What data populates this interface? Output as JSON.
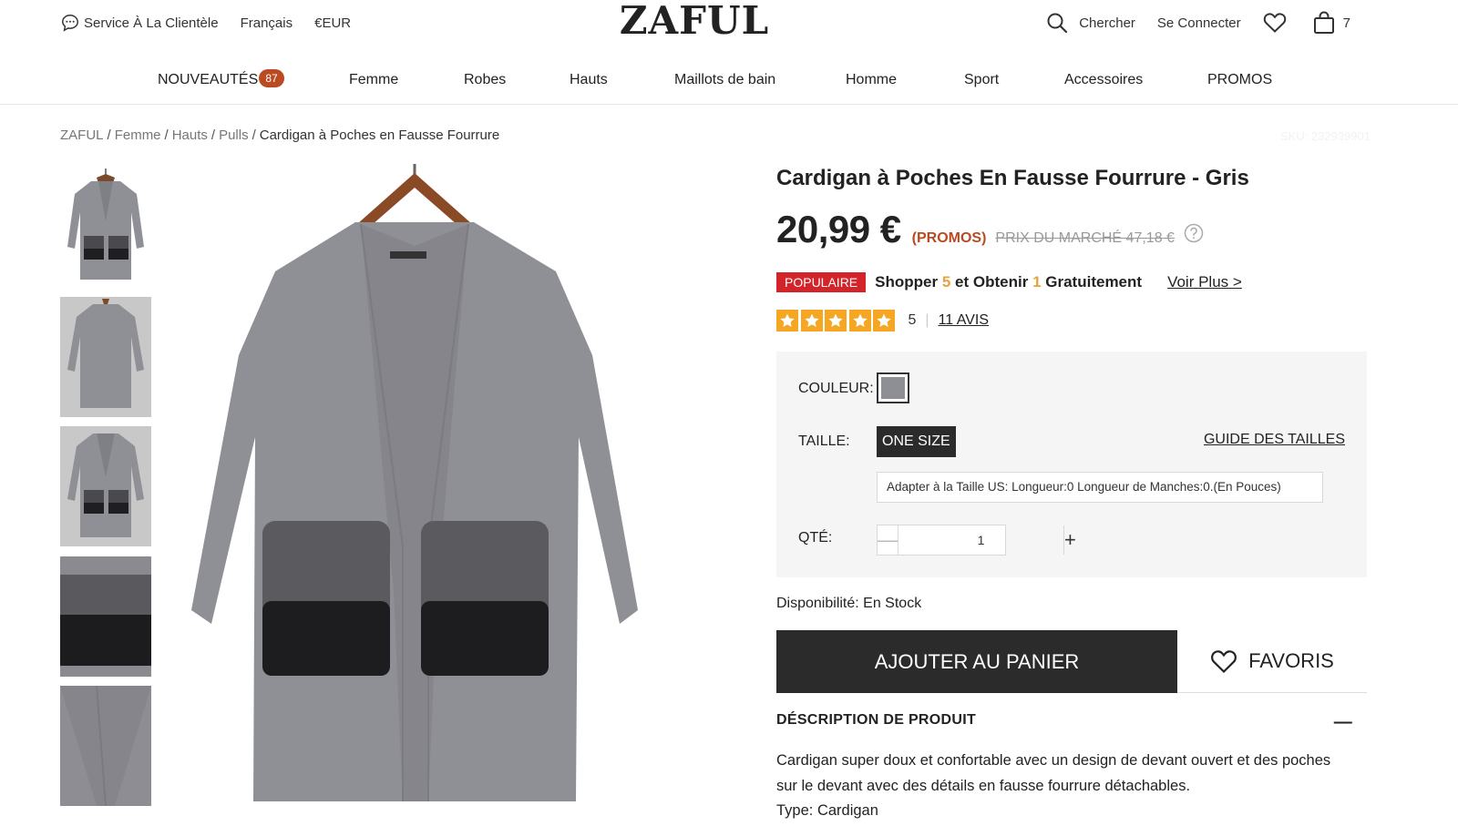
{
  "topbar": {
    "service": "Service À La Clientèle",
    "language": "Français",
    "currency": "€EUR",
    "logo": "ZAFUL",
    "search": "Chercher",
    "login": "Se Connecter",
    "cart_count": "7"
  },
  "nav": {
    "items": [
      {
        "label": "NOUVEAUTÉS",
        "badge": "87"
      },
      {
        "label": "Femme"
      },
      {
        "label": "Robes"
      },
      {
        "label": "Hauts"
      },
      {
        "label": "Maillots de bain"
      },
      {
        "label": "Homme"
      },
      {
        "label": "Sport"
      },
      {
        "label": "Accessoires"
      },
      {
        "label": "PROMOS"
      }
    ]
  },
  "breadcrumb": {
    "items": [
      "ZAFUL",
      "Femme",
      "Hauts",
      "Pulls"
    ],
    "current": "Cardigan à Poches en Fausse Fourrure",
    "sku": "SKU: 232939901"
  },
  "product": {
    "title": "Cardigan à Poches En Fausse Fourrure - Gris",
    "price": "20,99 €",
    "promo_tag": "(PROMOS)",
    "market_price": "PRIX DU MARCHÉ 47,18 €",
    "popular_badge": "POPULAIRE",
    "promo_text_1": "Shopper",
    "promo_num_1": "5",
    "promo_text_2": "et Obtenir",
    "promo_num_2": "1",
    "promo_text_3": "Gratuitement",
    "voir_plus": "Voir Plus >",
    "rating": "5",
    "rating_stars": 5,
    "reviews": "11 AVIS",
    "color_label": "COULEUR:",
    "color_value": "#8e8e95",
    "size_label": "TAILLE:",
    "size_value": "ONE SIZE",
    "size_guide": "GUIDE DES TAILLES",
    "fit_text": "Adapter à la Taille US:   Longueur:0   Longueur de Manches:0.(En Pouces)",
    "qty_label": "QTÉ:",
    "qty_value": "1",
    "availability": "Disponibilité: En Stock",
    "add_to_cart": "AJOUTER AU PANIER",
    "favorites": "FAVORIS",
    "description_heading": "DÉSCRIPTION DE PRODUIT",
    "description_toggle": "—",
    "description_lines": [
      "Cardigan super doux et confortable avec un design de devant ouvert et des poches",
      "sur le devant avec des détails en fausse fourrure détachables.",
      "Type: Cardigan"
    ]
  },
  "colors": {
    "accent": "#b94a21",
    "popular": "#d3242a",
    "star": "#f5a623",
    "dark_button": "#2b2b2b",
    "garment": "#8e8e95"
  }
}
